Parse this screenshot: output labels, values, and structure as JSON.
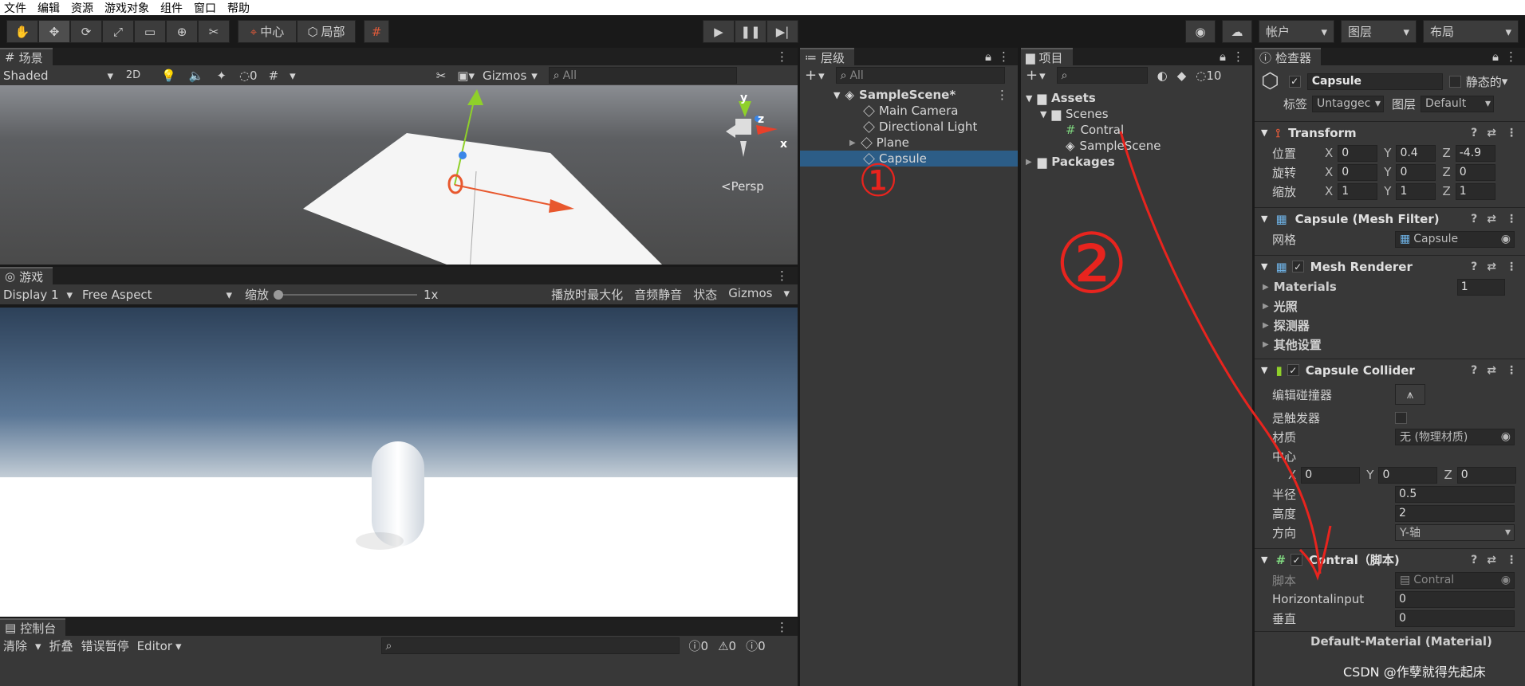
{
  "menu": [
    "文件",
    "编辑",
    "资源",
    "游戏对象",
    "组件",
    "窗口",
    "帮助"
  ],
  "toolbar": {
    "center": "中心",
    "local": "局部",
    "account": "帐户",
    "layers": "图层",
    "layout": "布局"
  },
  "scene": {
    "tab": "场景",
    "shading": "Shaded",
    "mode2d": "2D",
    "hidden_count": "0",
    "gizmos": "Gizmos",
    "search_placeholder": "All",
    "persp": "<Persp",
    "axis_y": "y",
    "axis_z": "z",
    "axis_x": "x"
  },
  "game": {
    "tab": "游戏",
    "display": "Display 1",
    "aspect": "Free Aspect",
    "scale_label": "缩放",
    "scale_value": "1x",
    "scale_level": 0.0,
    "maximize": "播放时最大化",
    "mute": "音频静音",
    "stats": "状态",
    "gizmos": "Gizmos"
  },
  "console": {
    "tab": "控制台",
    "clear": "清除",
    "collapse": "折叠",
    "error_pause": "错误暂停",
    "editor": "Editor",
    "info_count": "0",
    "warn_count": "0",
    "error_count": "0"
  },
  "hierarchy": {
    "tab": "层级",
    "search_placeholder": "All",
    "scene": "SampleScene*",
    "items": [
      "Main Camera",
      "Directional Light",
      "Plane",
      "Capsule"
    ]
  },
  "project": {
    "tab": "项目",
    "hidden_count": "10",
    "assets": "Assets",
    "scenes": "Scenes",
    "contral": "Contral",
    "samplescene": "SampleScene",
    "packages": "Packages"
  },
  "annotations": {
    "one": "①",
    "two": "②"
  },
  "inspector": {
    "tab": "检查器",
    "name": "Capsule",
    "static": "静态的",
    "tag_label": "标签",
    "tag_value": "Untaggec",
    "layer_label": "图层",
    "layer_value": "Default",
    "transform": {
      "title": "Transform",
      "pos": "位置",
      "rot": "旋转",
      "scale": "缩放",
      "x": "X",
      "y": "Y",
      "z": "Z",
      "pos_x": "0",
      "pos_y": "0.4",
      "pos_z": "-4.9",
      "rot_x": "0",
      "rot_y": "0",
      "rot_z": "0",
      "sc_x": "1",
      "sc_y": "1",
      "sc_z": "1"
    },
    "meshfilter": {
      "title": "Capsule (Mesh Filter)",
      "mesh_label": "网格",
      "mesh_value": "Capsule"
    },
    "meshrenderer": {
      "title": "Mesh Renderer",
      "materials": "Materials",
      "materials_count": "1",
      "lighting": "光照",
      "probes": "探测器",
      "other": "其他设置"
    },
    "collider": {
      "title": "Capsule Collider",
      "edit": "编辑碰撞器",
      "trigger": "是触发器",
      "material_label": "材质",
      "material_value": "无 (物理材质)",
      "center": "中心",
      "cx": "0",
      "cy": "0",
      "cz": "0",
      "radius_label": "半径",
      "radius": "0.5",
      "height_label": "高度",
      "height": "2",
      "direction_label": "方向",
      "direction": "Y-轴"
    },
    "script": {
      "title": "Contral（脚本)",
      "script_label": "脚本",
      "script_value": "Contral",
      "h_label": "Horizontalinput",
      "h_value": "0",
      "v_label": "垂直",
      "v_value": "0"
    },
    "next": "Default-Material (Material)"
  },
  "watermark": "CSDN @作孽就得先起床",
  "colors": {
    "selection": "#2c5d87",
    "annotation": "#e8241e",
    "play_bg": "#3c3c3c"
  }
}
